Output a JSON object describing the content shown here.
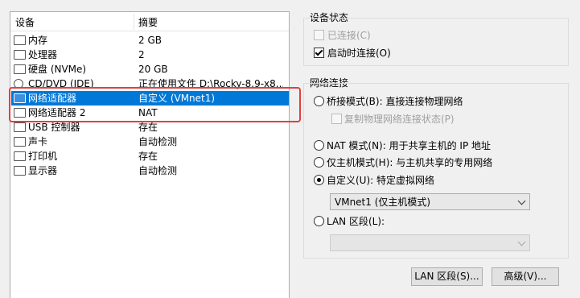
{
  "device_list": {
    "headers": {
      "device": "设备",
      "summary": "摘要"
    },
    "rows": [
      {
        "name": "内存",
        "summary": "2 GB"
      },
      {
        "name": "处理器",
        "summary": "2"
      },
      {
        "name": "硬盘 (NVMe)",
        "summary": "20 GB"
      },
      {
        "name": "CD/DVD (IDE)",
        "summary": "正在使用文件 D:\\Rocky-8.9-x8..."
      },
      {
        "name": "网络适配器",
        "summary": "自定义 (VMnet1)"
      },
      {
        "name": "网络适配器 2",
        "summary": "NAT"
      },
      {
        "name": "USB 控制器",
        "summary": "存在"
      },
      {
        "name": "声卡",
        "summary": "自动检测"
      },
      {
        "name": "打印机",
        "summary": "存在"
      },
      {
        "name": "显示器",
        "summary": "自动检测"
      }
    ],
    "selected_index": 4
  },
  "device_status": {
    "title": "设备状态",
    "connected_label": "已连接(C)",
    "connected_checked": false,
    "connect_at_power_on_label": "启动时连接(O)",
    "connect_at_power_on_checked": true
  },
  "network_connection": {
    "title": "网络连接",
    "bridged_label": "桥接模式(B): 直接连接物理网络",
    "replicate_label": "复制物理网络连接状态(P)",
    "nat_label": "NAT 模式(N): 用于共享主机的 IP 地址",
    "host_only_label": "仅主机模式(H): 与主机共享的专用网络",
    "custom_label": "自定义(U): 特定虚拟网络",
    "custom_value": "VMnet1 (仅主机模式)",
    "lan_label": "LAN 区段(L):",
    "lan_value": "",
    "selected": "custom"
  },
  "buttons": {
    "lan_segments": "LAN 区段(S)...",
    "advanced": "高级(V)..."
  },
  "colors": {
    "selection": "#0078d7",
    "highlight": "#e04040"
  }
}
